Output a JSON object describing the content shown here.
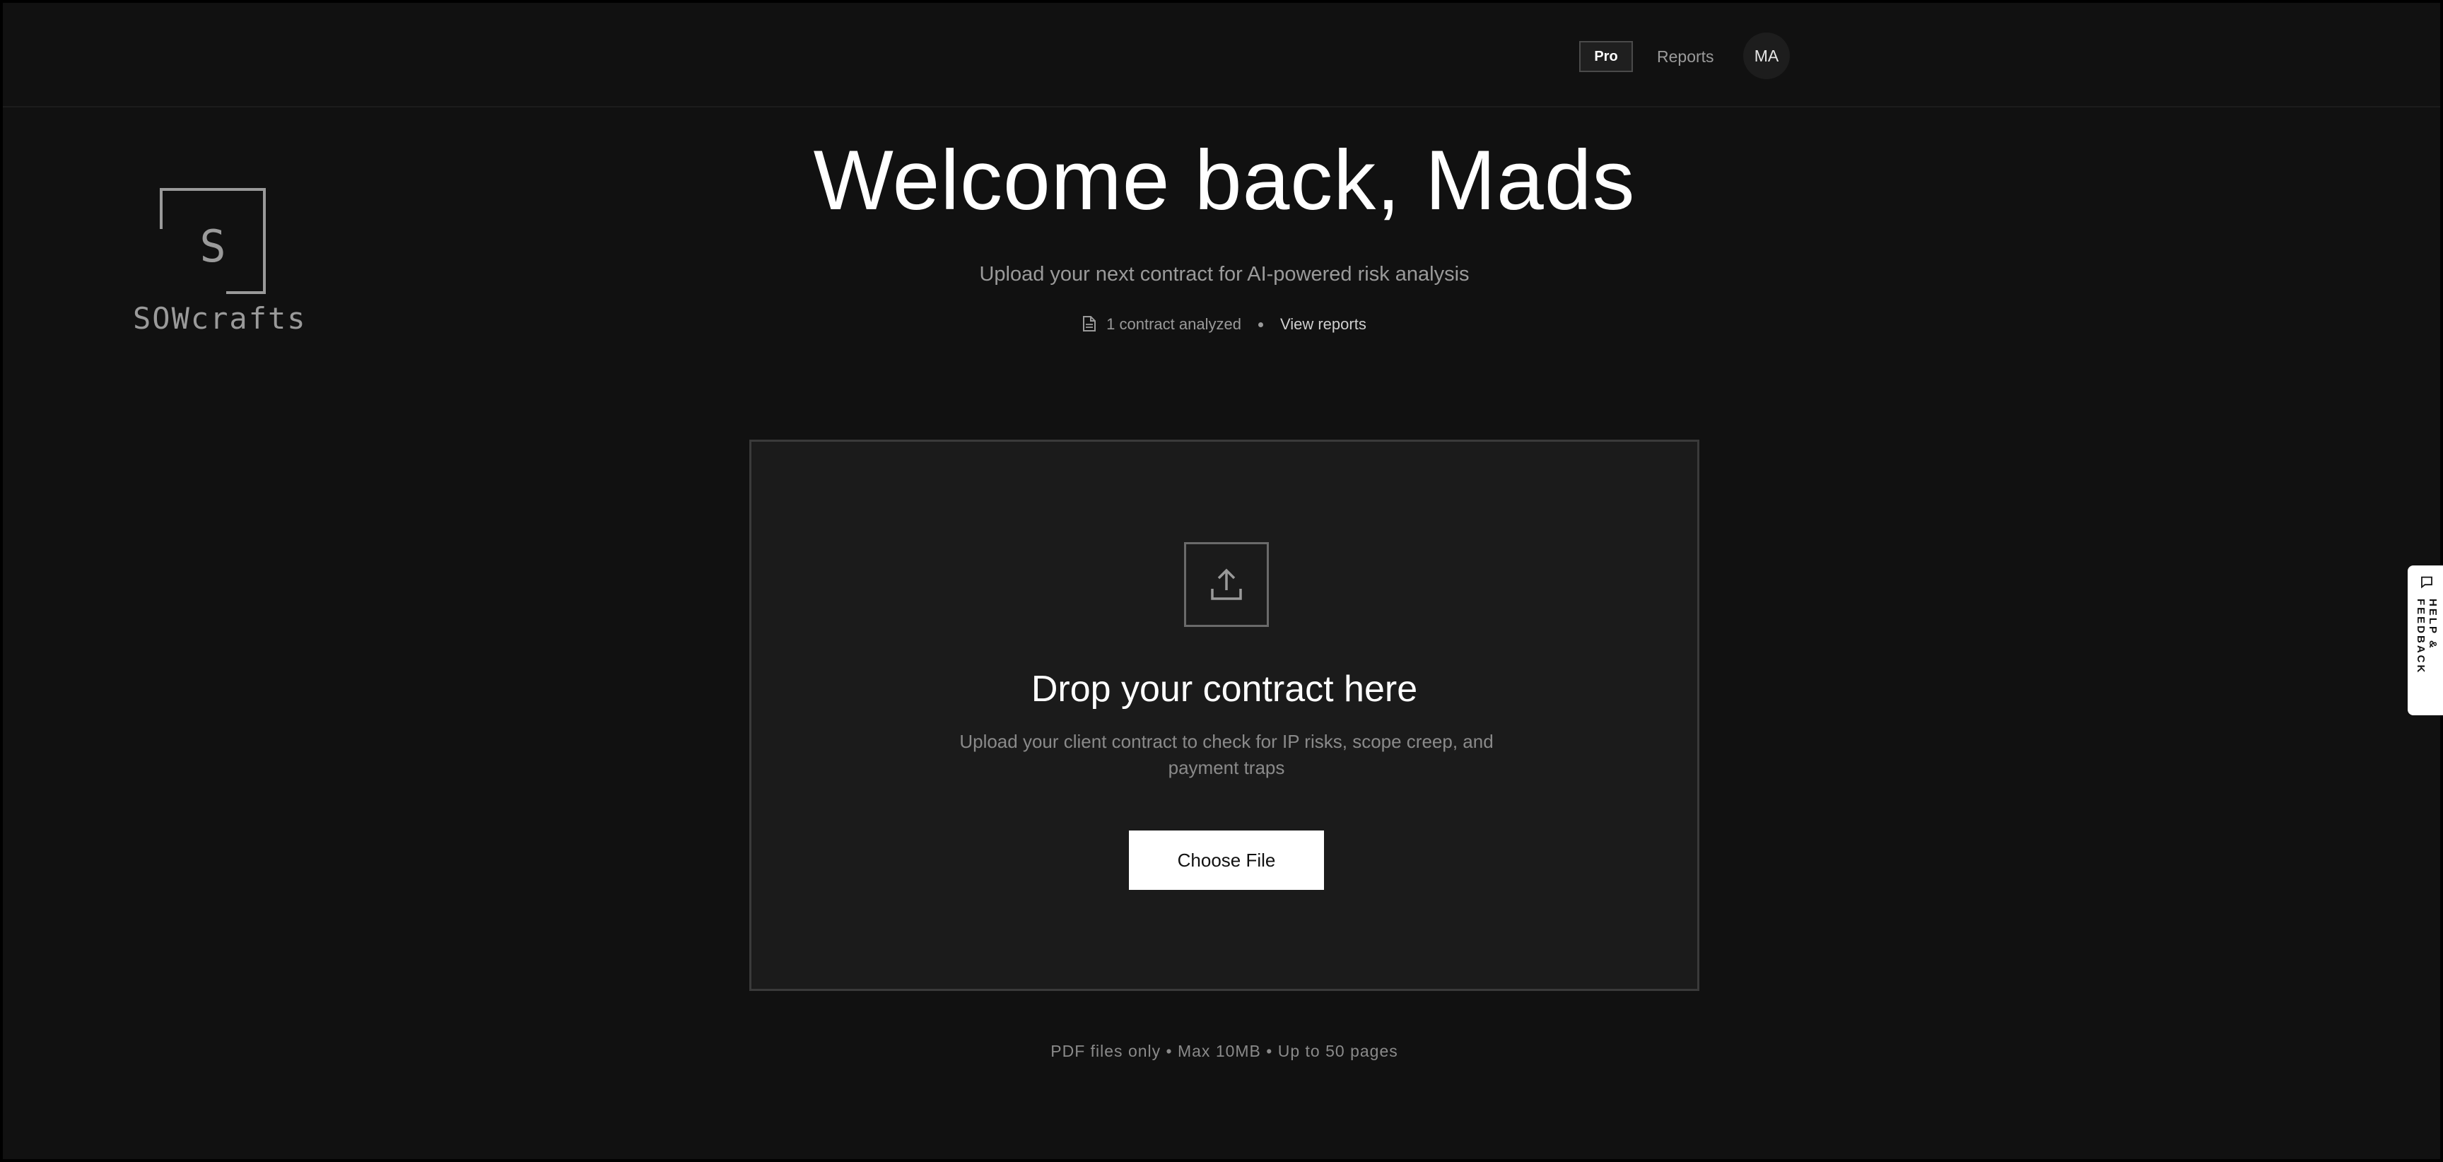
{
  "header": {
    "plan_badge": "Pro",
    "nav_reports": "Reports",
    "avatar_initials": "MA"
  },
  "brand": {
    "logo_letter": "S",
    "name": "SOWcrafts",
    "icon": "logo-square-icon"
  },
  "hero": {
    "title": "Welcome back, Mads",
    "subtitle": "Upload your next contract for AI-powered risk analysis",
    "contracts_count": "1 contract analyzed",
    "contracts_icon": "document-icon",
    "view_reports": "View reports"
  },
  "dropzone": {
    "icon": "upload-icon",
    "title": "Drop your contract here",
    "description": "Upload your client contract to check for IP risks, scope creep, and payment traps",
    "button_label": "Choose File"
  },
  "footnote": "PDF files only • Max 10MB • Up to 50 pages",
  "help_tab": {
    "icon": "chat-bubble-icon",
    "label": "HELP & FEEDBACK"
  },
  "colors": {
    "background": "#111111",
    "panel": "#1b1b1b",
    "text_primary": "#ffffff",
    "text_muted": "#9a9a9a",
    "button_bg": "#ffffff"
  }
}
